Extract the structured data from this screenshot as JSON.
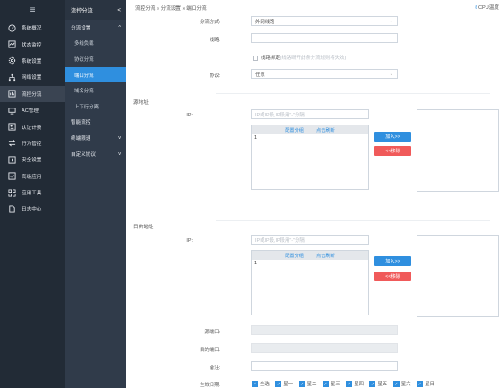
{
  "sidebar": {
    "menu_icon": "≡",
    "items": [
      {
        "label": "系统概况",
        "icon": "dashboard-icon"
      },
      {
        "label": "状态监控",
        "icon": "monitor-icon"
      },
      {
        "label": "系统设置",
        "icon": "settings-icon"
      },
      {
        "label": "网络设置",
        "icon": "network-icon"
      },
      {
        "label": "流控分流",
        "icon": "flow-control-icon"
      },
      {
        "label": "AC管理",
        "icon": "ac-icon"
      },
      {
        "label": "认证计费",
        "icon": "auth-icon"
      },
      {
        "label": "行为管控",
        "icon": "behavior-icon"
      },
      {
        "label": "安全设置",
        "icon": "security-icon"
      },
      {
        "label": "高级应用",
        "icon": "advanced-icon"
      },
      {
        "label": "应用工具",
        "icon": "tools-icon"
      },
      {
        "label": "日志中心",
        "icon": "log-icon"
      }
    ]
  },
  "subnav": {
    "title": "流控分流",
    "collapse": "<",
    "groups": [
      {
        "label": "分流设置",
        "arrow": "^"
      },
      {
        "label": "多线负载"
      },
      {
        "label": "协议分流"
      },
      {
        "label": "端口分流"
      },
      {
        "label": "域名分流"
      },
      {
        "label": "上下行分离"
      },
      {
        "label": "智能流控"
      },
      {
        "label": "终端限速",
        "arrow": "v"
      },
      {
        "label": "自定义协议",
        "arrow": "v"
      }
    ]
  },
  "breadcrumb": "流控分流 » 分流设置 » 端口分流",
  "cpu_label": "CPU温度",
  "form": {
    "method_label": "分流方式:",
    "method_value": "外网线路",
    "line_label": "线路:",
    "line_value": "",
    "bind_label": "线路绑定",
    "bind_hint": "(线路断开此条分流规则将失效)",
    "protocol_label": "协议:",
    "protocol_value": "任意",
    "src_section": "源地址",
    "src_ip_label": "IP:",
    "src_ip_placeholder": "IP或IP段,IP段用\"-\"分隔",
    "list_cfg": "配置分组",
    "list_refresh": "点击刷新",
    "list_first": "1",
    "add_btn": "加入>>",
    "remove_btn": "<<移除",
    "dst_section": "目的地址",
    "dst_ip_label": "IP:",
    "dst_ip_placeholder": "IP或IP段,IP段用\"-\"分隔",
    "src_port_label": "源端口:",
    "dst_port_label": "目的端口:",
    "remark_label": "备注:",
    "days_label": "生效日期:",
    "days": [
      "全选",
      "星一",
      "星二",
      "星三",
      "星四",
      "星五",
      "星六",
      "星日"
    ]
  }
}
